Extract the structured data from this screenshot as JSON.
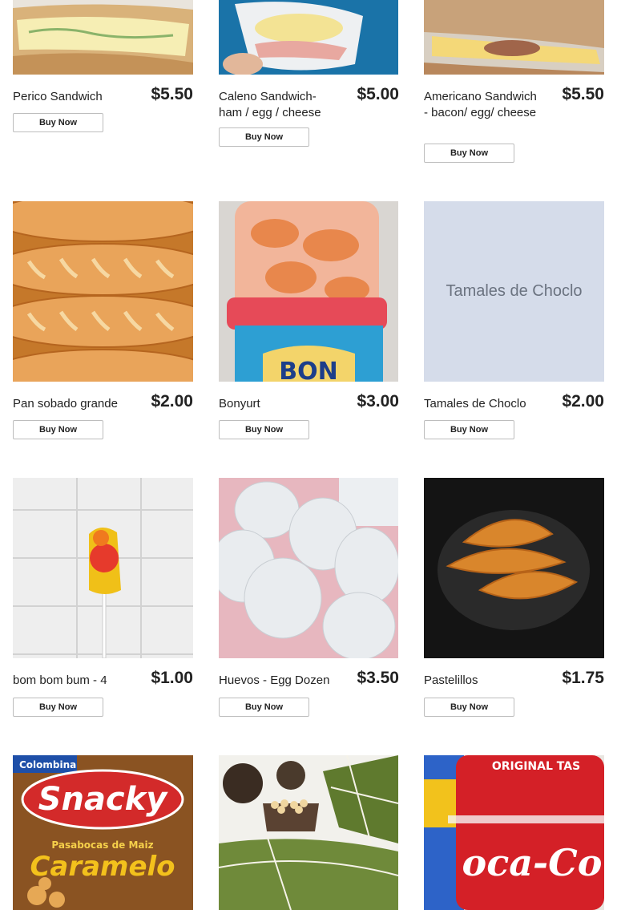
{
  "currency_note": "",
  "products": [
    {
      "name": "Perico Sandwich",
      "price": "$5.50",
      "button": "Buy Now",
      "image": "sandwich-egg-photo"
    },
    {
      "name": "Caleno Sandwich- ham / egg / cheese",
      "price": "$5.00",
      "button": "Buy Now",
      "image": "wrapped-sandwich-photo"
    },
    {
      "name": "Americano Sandwich - bacon/ egg/ cheese",
      "price": "$5.50",
      "button": "Buy Now",
      "image": "sausage-sandwich-photo"
    },
    {
      "name": "Pan sobado grande",
      "price": "$2.00",
      "button": "Buy Now",
      "image": "bread-loaves-photo"
    },
    {
      "name": "Bonyurt",
      "price": "$3.00",
      "button": "Buy Now",
      "image": "yogurt-cup-photo"
    },
    {
      "name": "Tamales de Choclo",
      "price": "$2.00",
      "button": "Buy Now",
      "image": "placeholder",
      "placeholder_text": "Tamales de Choclo"
    },
    {
      "name": "bom bom bum - 4",
      "price": "$1.00",
      "button": "Buy Now",
      "image": "lollipop-photo"
    },
    {
      "name": "Huevos - Egg Dozen",
      "price": "$3.50",
      "button": "Buy Now",
      "image": "eggs-photo"
    },
    {
      "name": "Pastelillos",
      "price": "$1.75",
      "button": "Buy Now",
      "image": "empanadas-photo"
    },
    {
      "name": "",
      "price": "",
      "button": "",
      "image": "snack-bag-photo",
      "brand": "Colombina",
      "logo": "Snacky",
      "sub": "Pasabocas de Maiz",
      "flavor": "Caramelo"
    },
    {
      "name": "",
      "price": "",
      "button": "",
      "image": "tamales-leaf-photo"
    },
    {
      "name": "",
      "price": "",
      "button": "",
      "image": "coca-cola-photo",
      "label_top": "ORIGINAL TAS",
      "logo": "oca-Co"
    }
  ]
}
